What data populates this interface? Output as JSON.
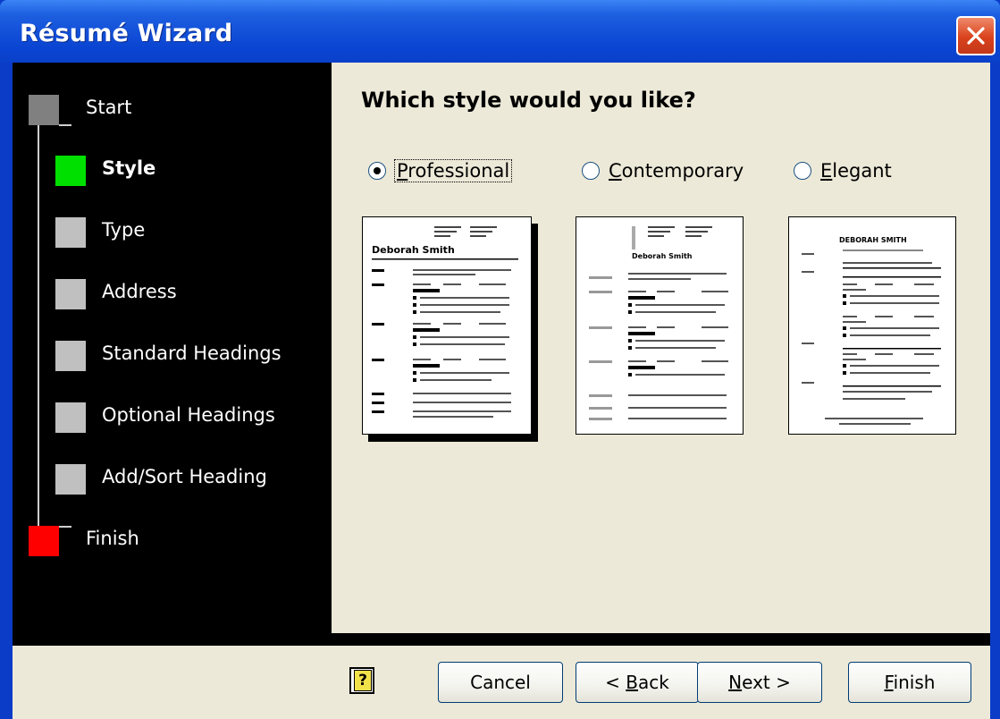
{
  "window": {
    "title": "Résumé Wizard"
  },
  "sidebar": {
    "steps": [
      {
        "label": "Start",
        "color": "#808080"
      },
      {
        "label": "Style",
        "color": "#00e000",
        "current": true
      },
      {
        "label": "Type",
        "color": "#c0c0c0"
      },
      {
        "label": "Address",
        "color": "#c0c0c0"
      },
      {
        "label": "Standard Headings",
        "color": "#c0c0c0"
      },
      {
        "label": "Optional Headings",
        "color": "#c0c0c0"
      },
      {
        "label": "Add/Sort Heading",
        "color": "#c0c0c0"
      },
      {
        "label": "Finish",
        "color": "#ff0000"
      }
    ]
  },
  "main": {
    "heading": "Which style would you like?",
    "options": [
      {
        "label_access": "P",
        "label_rest": "rofessional",
        "checked": true
      },
      {
        "label_access": "C",
        "label_rest": "ontemporary",
        "checked": false
      },
      {
        "label_access": "E",
        "label_rest": "legant",
        "checked": false
      }
    ],
    "previews": [
      {
        "name_text": "Deborah Smith"
      },
      {
        "name_text": "Deborah Smith"
      },
      {
        "name_text": "DEBORAH SMITH"
      }
    ]
  },
  "footer": {
    "help_icon": "question-icon",
    "help_glyph": "?",
    "cancel": "Cancel",
    "back_prefix": "< ",
    "back_access": "B",
    "back_rest": "ack",
    "next_access": "N",
    "next_rest": "ext >",
    "finish_access": "F",
    "finish_rest": "inish"
  }
}
